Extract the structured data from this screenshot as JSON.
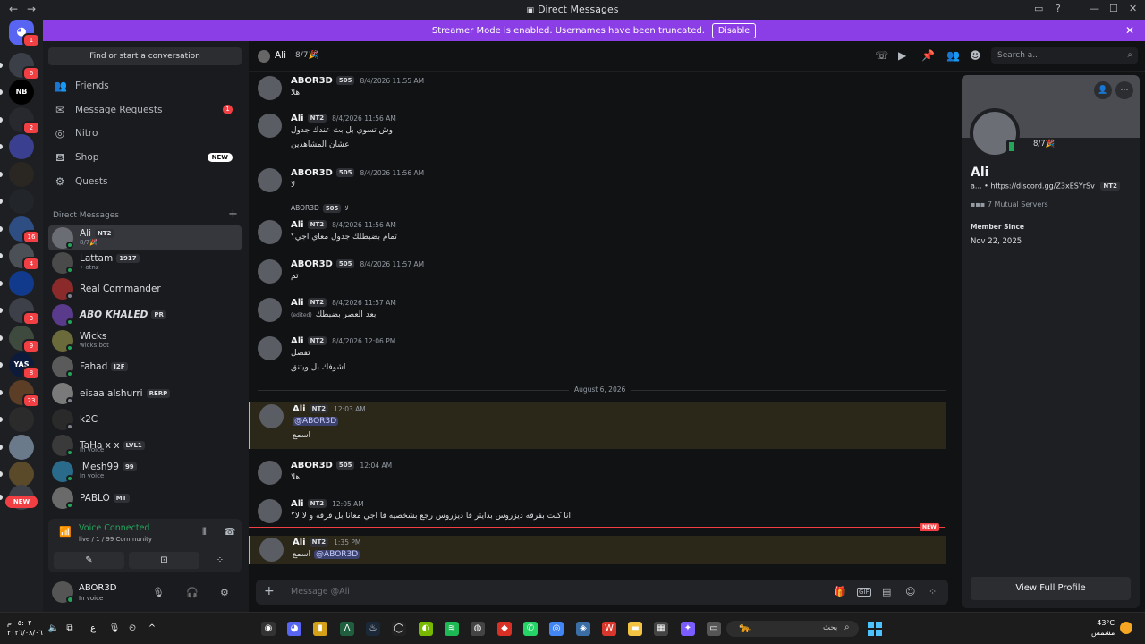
{
  "window": {
    "title": "Direct Messages",
    "back": "←",
    "forward": "→",
    "minimize": "—",
    "maximize": "☐",
    "close": "✕"
  },
  "banner": {
    "text": "Streamer Mode is enabled. Usernames have been truncated.",
    "button": "Disable",
    "close": "✕"
  },
  "rail": {
    "home_badge": "1",
    "servers": [
      {
        "badge": "6",
        "color": "#3b3f48"
      },
      {
        "label": "NB",
        "color": "#000000"
      },
      {
        "badge": "2",
        "color": "#27292e"
      },
      {
        "color": "#3a3f8f"
      },
      {
        "color": "#2a2622"
      },
      {
        "color": "#22252a"
      },
      {
        "badge": "16",
        "color": "#2d4d83"
      },
      {
        "badge": "4",
        "color": "#4b4f56"
      },
      {
        "color": "#123a8c"
      },
      {
        "badge": "3",
        "color": "#3d4048"
      },
      {
        "badge": "9",
        "color": "#3f4a3f"
      },
      {
        "label": "YAS",
        "badge": "8",
        "color": "#0c1b3b"
      },
      {
        "badge": "23",
        "color": "#5c3d25"
      },
      {
        "color": "#2b2b2b"
      },
      {
        "color": "#6b7a8a"
      },
      {
        "color": "#5a4a2a"
      },
      {
        "color": "#3d4048"
      }
    ],
    "new_label": "NEW"
  },
  "sidebar": {
    "find_placeholder": "Find or start a conversation",
    "nav": [
      {
        "label": "Friends",
        "icon": "friends-icon",
        "glyph": "👥"
      },
      {
        "label": "Message Requests",
        "icon": "mail-icon",
        "glyph": "✉",
        "count": "1"
      },
      {
        "label": "Nitro",
        "icon": "nitro-icon",
        "glyph": "◎"
      },
      {
        "label": "Shop",
        "icon": "shop-icon",
        "glyph": "⛾",
        "tag": "NEW"
      },
      {
        "label": "Quests",
        "icon": "quests-icon",
        "glyph": "⚙"
      }
    ],
    "dm_header": "Direct Messages",
    "dm_add": "+",
    "dms": [
      {
        "name": "Ali",
        "tag": "NT2",
        "sub": "8/7🎉",
        "online": true,
        "selected": true,
        "color": "#6a6d73"
      },
      {
        "name": "Lattam",
        "tag": "1917",
        "sub": "• otnz",
        "online": true,
        "color": "#4a4a4a"
      },
      {
        "name": "Real Commander",
        "online": false,
        "color": "#8a2a2a"
      },
      {
        "name": "ABO KHALED",
        "tag": "PR",
        "online": true,
        "color": "#5a3a8a"
      },
      {
        "name": "Wicks",
        "sub": "wicks.bot",
        "online": true,
        "color": "#6a6a3a"
      },
      {
        "name": "Fahad",
        "tag": "I2F",
        "online": true,
        "color": "#5a5a5a"
      },
      {
        "name": "eisaa alshurri",
        "tag": "RERP",
        "online": false,
        "color": "#7a7a7a"
      },
      {
        "name": "k2C",
        "online": false,
        "color": "#2a2a2a"
      },
      {
        "name": "TaHa x x",
        "tag": "LVL1",
        "online": true,
        "color": "#3a3a3a"
      },
      {
        "name": "iMesh99",
        "tag": "99",
        "sub": "In voice",
        "online": true,
        "color": "#2a6a8a"
      },
      {
        "name": "PABLO",
        "tag": "MT",
        "online": true,
        "color": "#6a6a6a"
      }
    ],
    "second_sub": "In voice"
  },
  "voice": {
    "title": "Voice Connected",
    "sub": "live / 1 / 99 Community",
    "signal": "📶",
    "btn1": "✎",
    "btn2": "⊡",
    "btn3": "⁘",
    "wave": "⦀",
    "hangup": "☎"
  },
  "user": {
    "name": "ABOR3D",
    "sub": "In voice",
    "mic": "🎙",
    "headset": "🎧",
    "settings": "⚙"
  },
  "chat_header": {
    "name": "Ali",
    "status": "8/7🎉",
    "search_placeholder": "Search a...",
    "search_icon": "⌕",
    "icons": [
      "☏",
      "▶",
      "📌",
      "👥",
      "☻"
    ]
  },
  "messages": [
    {
      "author": "ABOR3D",
      "tag": "505",
      "time": "8/4/2026 11:55 AM",
      "lines": [
        "هلا"
      ]
    },
    {
      "author": "Ali",
      "tag": "NT2",
      "time": "8/4/2026 11:56 AM",
      "lines": [
        "وش تسوي بل بث عندك جدول",
        "عشان المشاهدين"
      ]
    },
    {
      "author": "ABOR3D",
      "tag": "505",
      "time": "8/4/2026 11:56 AM",
      "lines": [
        "لا"
      ]
    },
    {
      "reply": "ABOR3D",
      "reply_tag": "505",
      "reply_text": "لا",
      "author": "Ali",
      "tag": "NT2",
      "time": "8/4/2026 11:56 AM",
      "lines": [
        "تمام بضبطلك جدول معاي اجي؟"
      ]
    },
    {
      "author": "ABOR3D",
      "tag": "505",
      "time": "8/4/2026 11:57 AM",
      "lines": [
        "تم"
      ]
    },
    {
      "author": "Ali",
      "tag": "NT2",
      "time": "8/4/2026 11:57 AM",
      "edited": "(edited)",
      "lines": [
        "بعد العصر بضبطك"
      ]
    },
    {
      "author": "Ali",
      "tag": "NT2",
      "time": "8/4/2026 12:06 PM",
      "lines": [
        "تفضل",
        "اشوفك بل ويتنق"
      ]
    },
    {
      "author": "Ali",
      "tag": "NT2",
      "time": "12:03 AM",
      "mention": "@ABOR3D",
      "lines": [
        "اسمع"
      ],
      "highlight": true
    },
    {
      "author": "ABOR3D",
      "tag": "505",
      "time": "12:04 AM",
      "lines": [
        "هلا"
      ]
    },
    {
      "author": "Ali",
      "tag": "NT2",
      "time": "12:05 AM",
      "lines": [
        "انا كنت بفرقه ديزروس بدايتر فا ديزروس رجع بشخصيه فا اجي معانا بل فرقه و لا لا؟"
      ]
    },
    {
      "author": "Ali",
      "tag": "NT2",
      "time": "1:35 PM",
      "lines": [
        "اسمع"
      ],
      "mention_after": "@ABOR3D",
      "highlight": true
    }
  ],
  "date_divider": "August 6, 2026",
  "new_marker": "NEW",
  "composer": {
    "placeholder": "Message @Ali",
    "plus": "+",
    "icons": [
      "🎁",
      "GIF",
      "▤",
      "☺",
      "⁘"
    ]
  },
  "profile": {
    "status": "8/7🎉",
    "name": "Ali",
    "bio": "a... • https://discord.gg/Z3xESYrSv",
    "bio_tag": "NT2",
    "mutual": "7 Mutual Servers",
    "member_since_label": "Member Since",
    "member_since": "Nov 22, 2025",
    "full_profile": "View Full Profile",
    "add_friend": "👤",
    "more": "⋯"
  },
  "taskbar": {
    "time": "٠٥:٠٢ م",
    "date": "٢٠٢٦/٠٨/٠٦",
    "weather_temp": "43°C",
    "weather_desc": "مشمس",
    "search": "بحث"
  }
}
